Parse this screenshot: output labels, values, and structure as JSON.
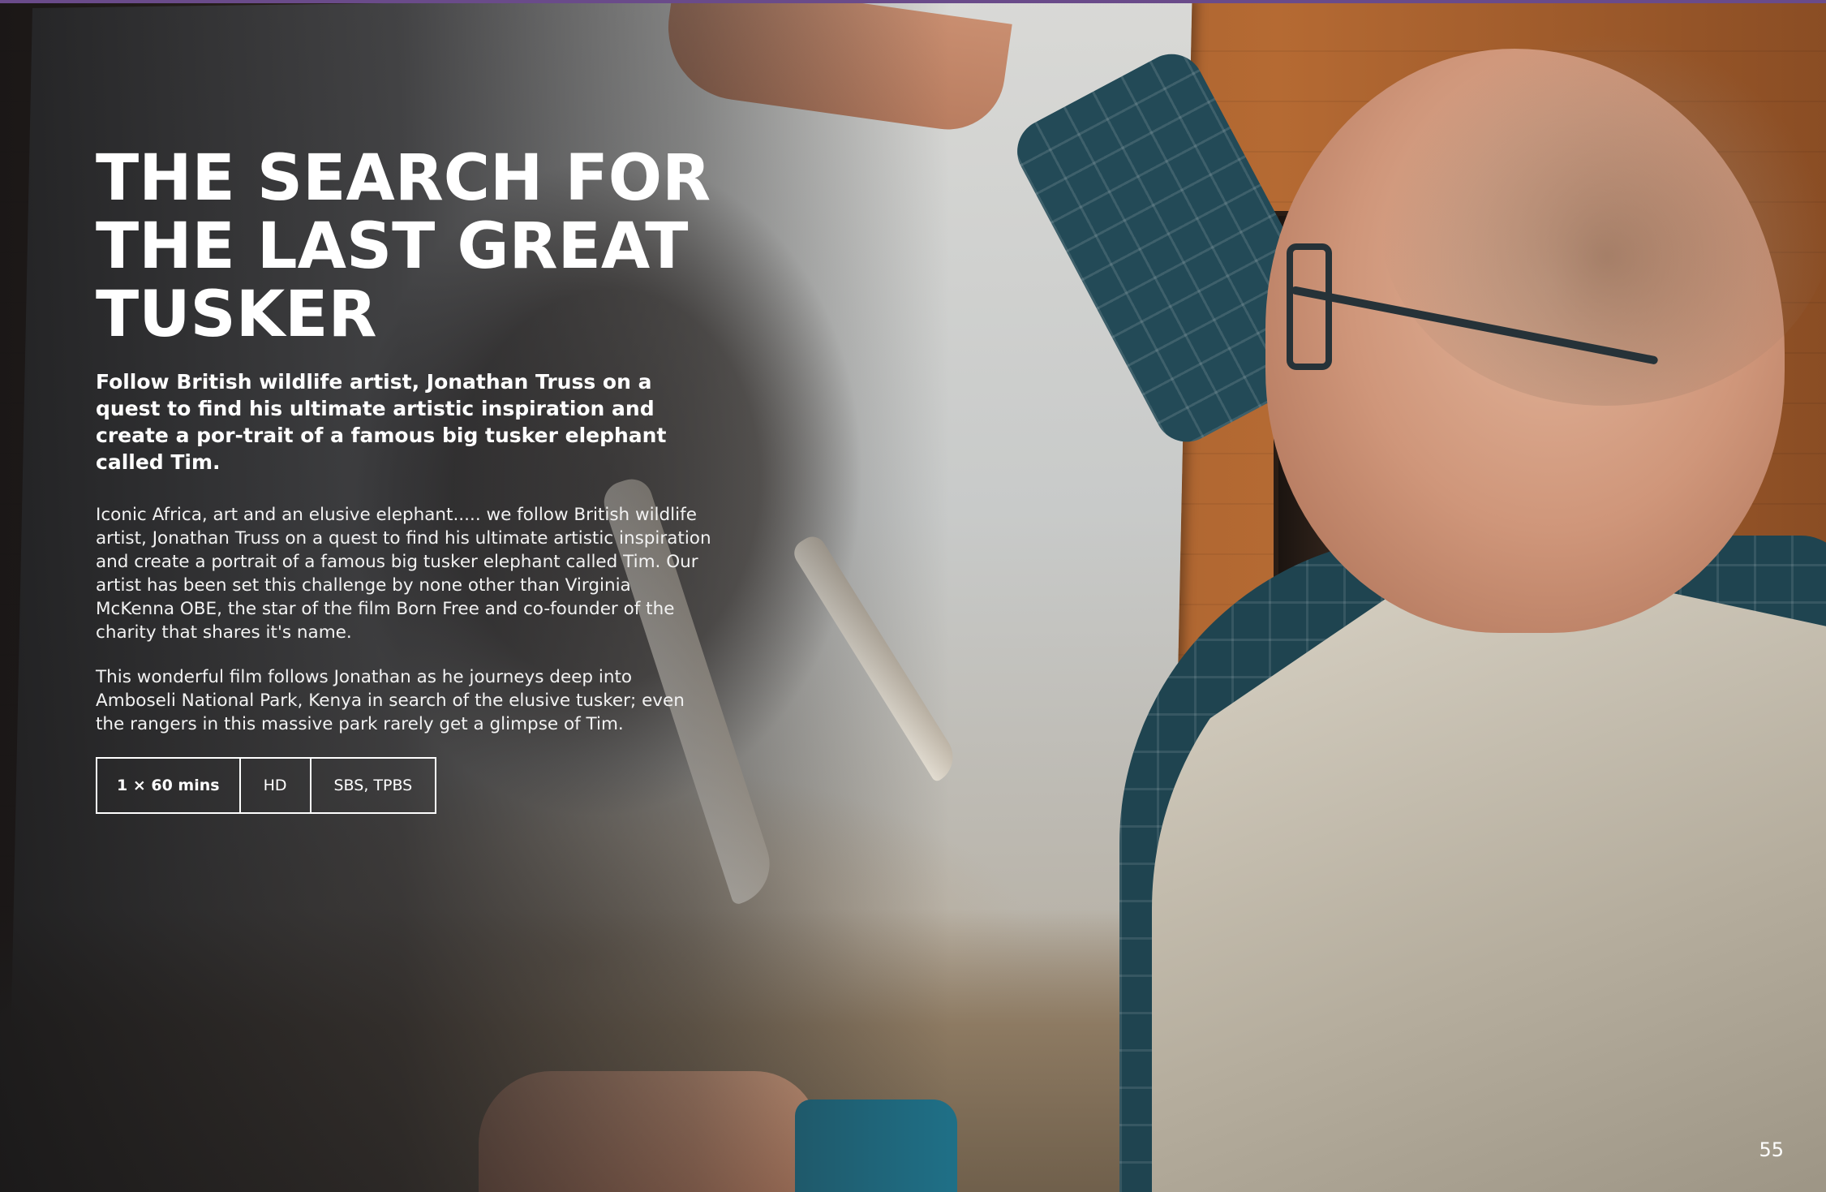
{
  "article": {
    "title": "THE SEARCH FOR THE LAST GREAT TUSKER",
    "subtitle": "Follow British wildlife artist, Jonathan Truss on a quest to find his ultimate artistic inspiration and create a por-trait of a famous big tusker elephant called Tim.",
    "paragraphs": [
      "Iconic Africa, art and an elusive elephant..... we follow British wildlife artist, Jonathan Truss on a quest to find his ultimate artistic inspiration and create a portrait of a famous big tusker elephant called Tim. Our artist has been set this challenge by none other than Virginia McKenna OBE, the star of the film Born Free and co-founder of the charity that shares it's name.",
      "This wonderful film follows Jonathan as he journeys deep into Amboseli National Park, Kenya in search of the elusive tusker; even the rangers in this massive park rarely get a glimpse of Tim."
    ],
    "specs": [
      "1 × 60 mins",
      "HD",
      "SBS, TPBS"
    ]
  },
  "page_number": "55",
  "colors": {
    "text": "#ffffff",
    "accent_line": "#6a4b8a"
  }
}
